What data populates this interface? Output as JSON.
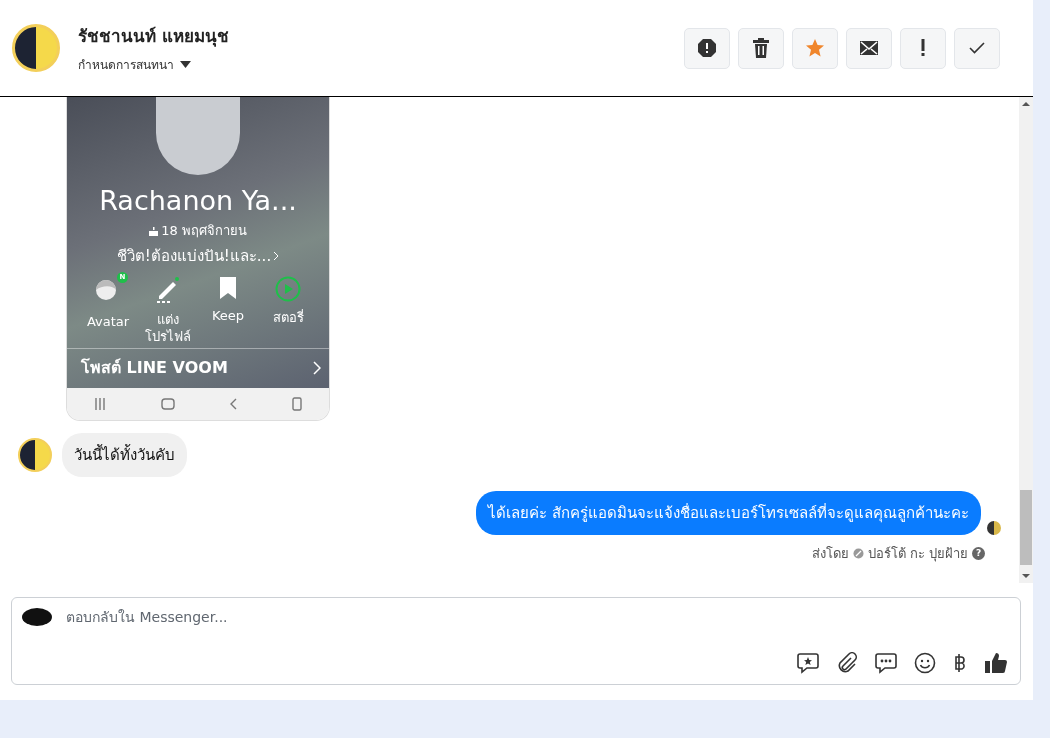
{
  "header": {
    "contact_name": "รัชชานนท์ แหยมนุช",
    "subtitle": "กำหนดการสนทนา",
    "toolbar": [
      {
        "kind": "alert"
      },
      {
        "kind": "trash"
      },
      {
        "kind": "star"
      },
      {
        "kind": "mail"
      },
      {
        "kind": "exclaim"
      },
      {
        "kind": "check"
      }
    ]
  },
  "messages": [
    {
      "kind": "image",
      "screenshot": {
        "name": "Rachanon Ya...",
        "date": "18 พฤศจิกายน",
        "status": "ชีวิต!ต้องแบ่งปัน!และ...",
        "actions": [
          {
            "kind": "avatar",
            "label": "Avatar",
            "badge": "N"
          },
          {
            "kind": "edit",
            "label": "แต่ง โปรไฟล์"
          },
          {
            "kind": "keep",
            "label": "Keep"
          },
          {
            "kind": "story",
            "label": "สตอรี่"
          }
        ],
        "voom_label": "โพสต์ LINE VOOM"
      }
    },
    {
      "kind": "incoming",
      "text": "วันนี้ได้ทั้งวันคับ"
    },
    {
      "kind": "outgoing",
      "text": "ได้เลยค่ะ สักครู่แอดมินจะแจ้งชื่อและเบอร์โทรเซลล์ที่จะดูแลคุณลูกค้านะคะ",
      "sent_by": "ส่งโดย",
      "sender": "ปอร์โต้ กะ ปุยฝ้าย",
      "help_icon": "?"
    }
  ],
  "composer": {
    "placeholder": "ตอบกลับใน Messenger...",
    "tools": [
      {
        "kind": "sticker"
      },
      {
        "kind": "attach"
      },
      {
        "kind": "chat"
      },
      {
        "kind": "emoji"
      },
      {
        "kind": "baht"
      },
      {
        "kind": "like"
      }
    ]
  }
}
